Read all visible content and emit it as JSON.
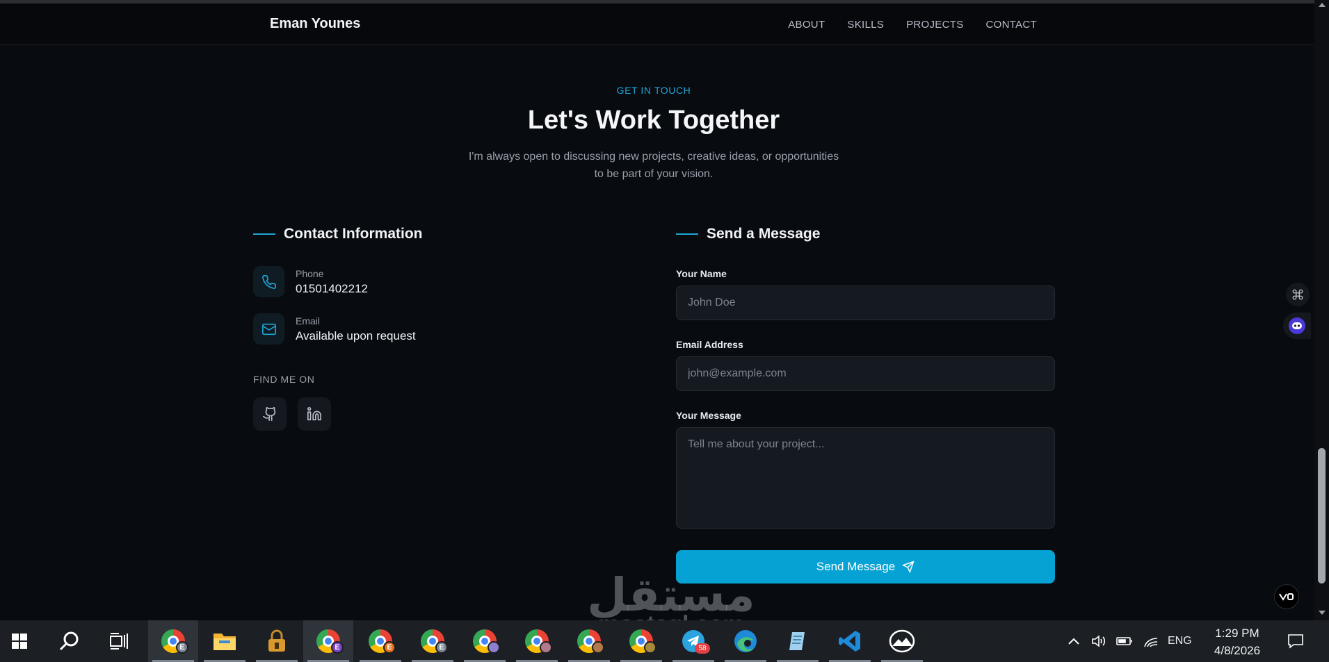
{
  "navbar": {
    "brand": "Eman Younes",
    "links": [
      "ABOUT",
      "SKILLS",
      "PROJECTS",
      "CONTACT"
    ]
  },
  "hero": {
    "eyebrow": "GET IN TOUCH",
    "title": "Let's Work Together",
    "lede_line1": "I'm always open to discussing new projects, creative ideas, or opportunities",
    "lede_line2": "to be part of your vision."
  },
  "contact_info": {
    "title": "Contact Information",
    "phone_label": "Phone",
    "phone_value": "01501402212",
    "email_label": "Email",
    "email_value": "Available upon request",
    "find_me_label": "FIND ME ON",
    "socials": [
      "github-icon",
      "linkedin-icon"
    ]
  },
  "message_form": {
    "title": "Send a Message",
    "name_label": "Your Name",
    "name_placeholder": "John Doe",
    "name_value": "",
    "email_label": "Email Address",
    "email_placeholder": "john@example.com",
    "email_value": "",
    "message_label": "Your Message",
    "message_placeholder": "Tell me about your project...",
    "message_value": "",
    "submit_label": "Send Message"
  },
  "watermark": {
    "arabic": "مستقل",
    "latin": "mostaql.com"
  },
  "taskbar": {
    "apps": [
      {
        "icon": "chrome-icon",
        "profile": "E",
        "badge_color": "#7a8592",
        "active": true
      },
      {
        "icon": "file-explorer-icon"
      },
      {
        "icon": "keepass-lock-icon"
      },
      {
        "icon": "chrome-icon",
        "profile": "E",
        "badge_color": "#7b3fc6",
        "active": true
      },
      {
        "icon": "chrome-icon",
        "profile": "E",
        "badge_color": "#e8711b"
      },
      {
        "icon": "chrome-icon",
        "profile": "E",
        "badge_color": "#7a8592"
      },
      {
        "icon": "chrome-icon",
        "profile": "person",
        "badge_color": "#8e7fd1"
      },
      {
        "icon": "chrome-icon",
        "profile": "person",
        "badge_color": "#b37a8e"
      },
      {
        "icon": "chrome-icon",
        "profile": "person",
        "badge_color": "#b27a4a"
      },
      {
        "icon": "chrome-icon",
        "profile": "person",
        "badge_color": "#a88a3c"
      },
      {
        "icon": "telegram-icon",
        "count": "58"
      },
      {
        "icon": "edge-icon"
      },
      {
        "icon": "notepad-icon"
      },
      {
        "icon": "vscode-icon"
      },
      {
        "icon": "mountain-app-icon"
      }
    ],
    "language": "ENG",
    "time": "1:29 PM",
    "date": "4/8/2026"
  },
  "colors": {
    "accent": "#06a2d4",
    "background": "#080b10",
    "nav_background": "#06080c",
    "input_background": "#151920"
  }
}
